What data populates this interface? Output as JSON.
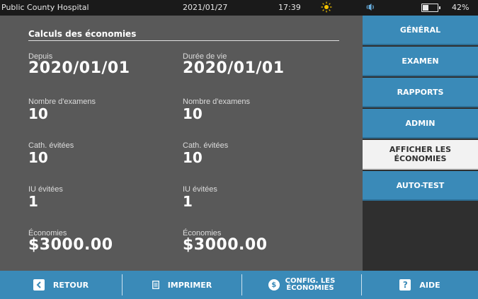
{
  "status_bar": {
    "hospital": "Public County Hospital",
    "date": "2021/01/27",
    "time": "17:39",
    "battery_percent": "42%",
    "battery_level": 0.42,
    "icons": [
      "brightness-icon",
      "volume-icon",
      "battery-icon"
    ]
  },
  "main": {
    "section_title": "Calculs des économies",
    "left_column": [
      {
        "label": "Depuis",
        "value": "2020/01/01"
      },
      {
        "label": "Nombre d'examens",
        "value": "10"
      },
      {
        "label": "Cath. évitées",
        "value": "10"
      },
      {
        "label": "IU évitées",
        "value": "1"
      },
      {
        "label": "Économies",
        "value": "$3000.00"
      }
    ],
    "right_column": [
      {
        "label": "Durée de vie",
        "value": "2020/01/01"
      },
      {
        "label": "Nombre d'examens",
        "value": "10"
      },
      {
        "label": "Cath. évitées",
        "value": "10"
      },
      {
        "label": "IU évitées",
        "value": "1"
      },
      {
        "label": "Économies",
        "value": "$3000.00"
      }
    ]
  },
  "menu": {
    "items": [
      {
        "label": "GÉNÉRAL",
        "active": false
      },
      {
        "label": "EXAMEN",
        "active": false
      },
      {
        "label": "RAPPORTS",
        "active": false
      },
      {
        "label": "ADMIN",
        "active": false
      },
      {
        "label": "AFFICHER LES ÉCONOMIES",
        "active": true
      },
      {
        "label": "AUTO-TEST",
        "active": false
      }
    ]
  },
  "footer": {
    "back_label": "RETOUR",
    "print_label": "IMPRIMER",
    "config_label_line1": "CONFIG. LES",
    "config_label_line2": "ÉCONOMIES",
    "config_icon_glyph": "$",
    "help_label": "AIDE",
    "help_icon_glyph": "?",
    "icons": [
      "chevron-left-icon",
      "print-icon",
      "dollar-icon",
      "help-icon"
    ]
  },
  "colors": {
    "accent_blue": "#3a8ab8",
    "panel_gray": "#595959",
    "active_menu": "#f2f2f2"
  }
}
